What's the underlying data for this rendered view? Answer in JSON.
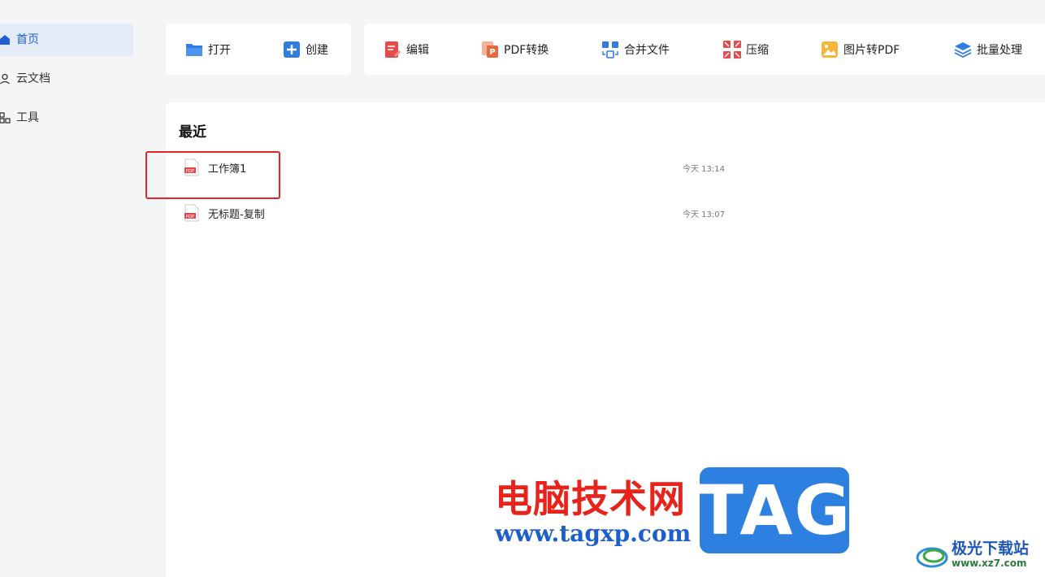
{
  "sidebar": {
    "items": [
      {
        "label": "首页",
        "icon": "home-icon",
        "active": true
      },
      {
        "label": "云文档",
        "icon": "cloud-doc-icon",
        "active": false
      },
      {
        "label": "工具",
        "icon": "tools-icon",
        "active": false
      }
    ]
  },
  "toolbar": {
    "open": "打开",
    "create": "创建",
    "edit": "编辑",
    "pdf_convert": "PDF转换",
    "merge": "合并文件",
    "compress": "压缩",
    "image_to_pdf": "图片转PDF",
    "batch": "批量处理"
  },
  "recent": {
    "title": "最近",
    "files": [
      {
        "name": "工作簿1",
        "time": "今天 13:14",
        "icon": "pdf-file-icon"
      },
      {
        "name": "无标题-复制",
        "time": "今天 13:07",
        "icon": "pdf-file-icon"
      }
    ]
  },
  "watermark": {
    "brand_cn": "电脑技术网",
    "brand_url": "www.tagxp.com",
    "tag": "TAG",
    "site_name": "极光下载站",
    "site_url": "www.xz7.com"
  },
  "colors": {
    "accent": "#1f5fd1",
    "highlight": "#e02626",
    "pdf_red": "#e04a4a"
  }
}
